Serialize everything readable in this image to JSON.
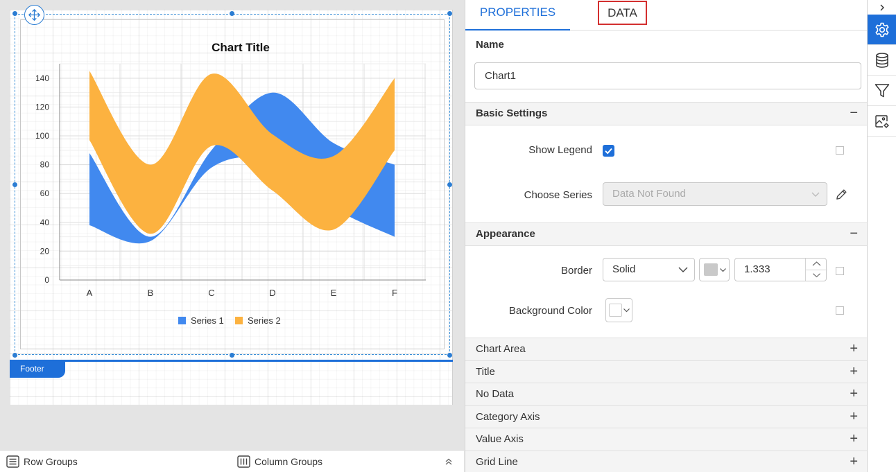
{
  "chart": {
    "title": "Chart Title",
    "legend": [
      "Series 1",
      "Series 2"
    ],
    "footer_label": "Footer"
  },
  "chart_data": {
    "type": "area",
    "subtype": "range-spline",
    "title": "Chart Title",
    "categories": [
      "A",
      "B",
      "C",
      "D",
      "E",
      "F"
    ],
    "ylim": [
      0,
      150
    ],
    "yticks": [
      0,
      20,
      40,
      60,
      80,
      100,
      120,
      140
    ],
    "grid": true,
    "legend_position": "bottom",
    "series": [
      {
        "name": "Series 1",
        "color": "#4189ef",
        "low": [
          38,
          27,
          78,
          82,
          50,
          30
        ],
        "high": [
          88,
          30,
          90,
          130,
          95,
          80
        ]
      },
      {
        "name": "Series 2",
        "color": "#fcb240",
        "low": [
          97,
          32,
          93,
          62,
          35,
          90
        ],
        "high": [
          145,
          80,
          143,
          101,
          86,
          140
        ]
      }
    ]
  },
  "bottom_bar": {
    "row_groups": "Row Groups",
    "column_groups": "Column Groups"
  },
  "panel": {
    "tabs": {
      "properties": "PROPERTIES",
      "data": "DATA"
    },
    "name_label": "Name",
    "name_value": "Chart1",
    "sections": {
      "basic": "Basic Settings",
      "appearance": "Appearance",
      "collapsed": [
        "Chart Area",
        "Title",
        "No Data",
        "Category Axis",
        "Value Axis",
        "Grid Line"
      ]
    },
    "show_legend_label": "Show Legend",
    "choose_series_label": "Choose Series",
    "choose_series_placeholder": "Data Not Found",
    "border_label": "Border",
    "border_style": "Solid",
    "border_width": "1.333",
    "background_color_label": "Background Color",
    "accent_color": "#1e6fd9"
  }
}
